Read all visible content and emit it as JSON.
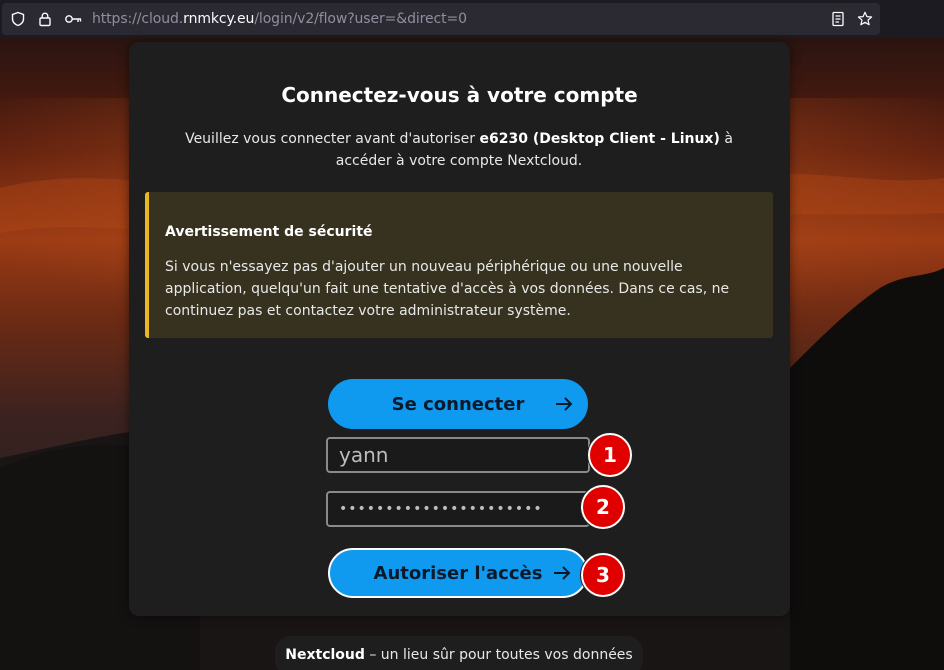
{
  "browser": {
    "url_prefix": "https://cloud.",
    "url_host": "rnmkcy.eu",
    "url_path": "/login/v2/flow?user=&direct=0",
    "icons": [
      "shield-icon",
      "lock-icon",
      "key-icon",
      "reader-mode-icon",
      "bookmark-star-icon"
    ]
  },
  "login": {
    "title": "Connectez-vous à votre compte",
    "desc_before": "Veuillez vous connecter avant d'autoriser ",
    "desc_client": "e6230 (Desktop Client - Linux)",
    "desc_after": " à accéder à votre compte Nextcloud.",
    "warning_title": "Avertissement de sécurité",
    "warning_body": "Si vous n'essayez pas d'ajouter un nouveau périphérique ou une nouvelle application, quelqu'un fait une tentative d'accès à vos données. Dans ce cas, ne continuez pas et contactez votre administrateur système.",
    "connect_button": "Se connecter",
    "username_value": "yann",
    "password_mask": "••••••••••••••••••••••",
    "authorize_button": "Autoriser l'accès"
  },
  "annotations": {
    "badge_1": "1",
    "badge_2": "2",
    "badge_3": "3"
  },
  "footer": {
    "brand": "Nextcloud",
    "tagline": " – un lieu sûr pour toutes vos données"
  },
  "colors": {
    "primary": "#0f9af0",
    "warning_accent": "#e9b722",
    "badge": "#e00000"
  }
}
